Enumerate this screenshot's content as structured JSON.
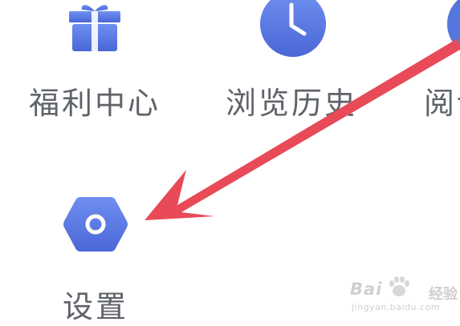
{
  "grid": {
    "items": [
      {
        "id": "welfare",
        "label": "福利中心",
        "icon": "gift-icon"
      },
      {
        "id": "history",
        "label": "浏览历史",
        "icon": "clock-icon"
      },
      {
        "id": "reading",
        "label": "阅读",
        "icon": "book-icon"
      },
      {
        "id": "settings",
        "label": "设置",
        "icon": "gear-hexagon-icon"
      }
    ]
  },
  "annotation": {
    "arrow_color": "#e84a57",
    "points_to": "settings"
  },
  "theme": {
    "icon_color": "#5577dd",
    "label_color": "#5e6269"
  },
  "watermark": {
    "brand": "Bai",
    "brand_cn": "经验",
    "url": "jingyan.baidu.com"
  }
}
